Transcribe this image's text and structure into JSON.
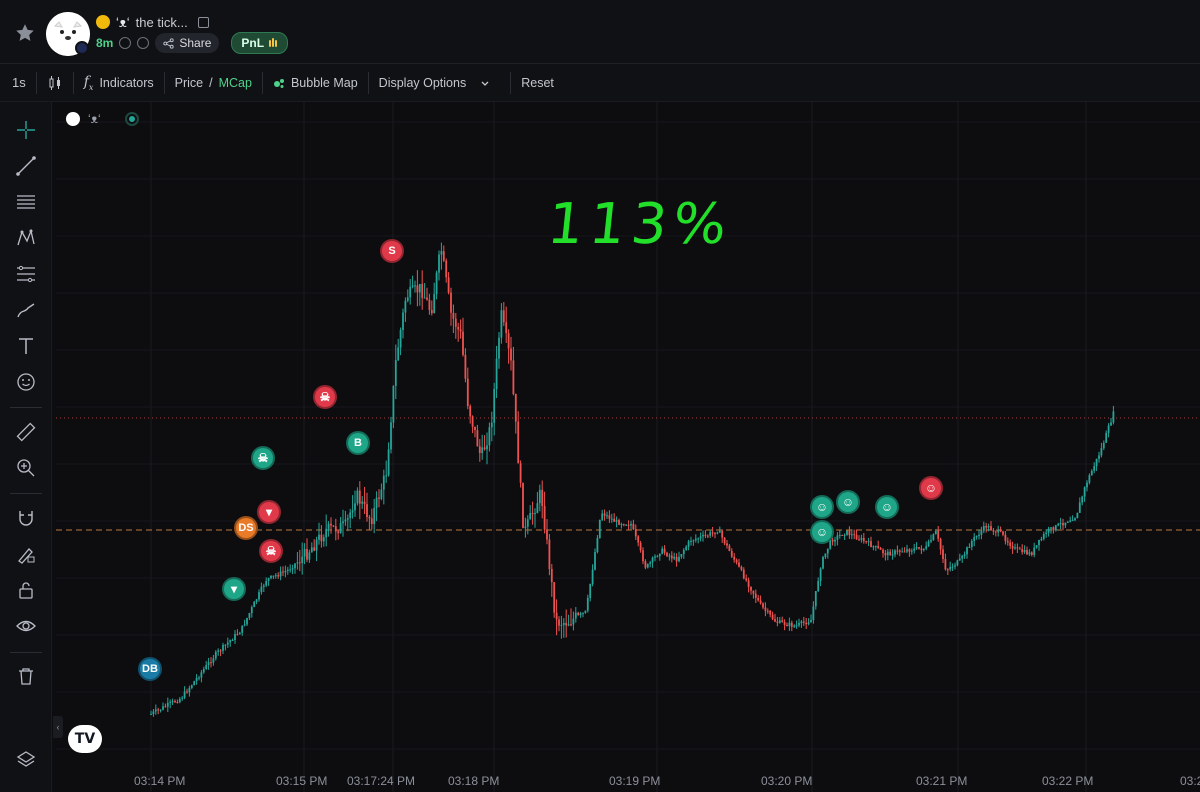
{
  "header": {
    "token_symbol": "ʻᴥʻ",
    "token_name": "the tick...",
    "age": "8m",
    "share_label": "Share",
    "pnl_label": "PnL"
  },
  "toolbar": {
    "interval": "1s",
    "indicators_label": "Indicators",
    "price_label": "Price",
    "slash": "/",
    "mcap_label": "MCap",
    "bubble_map_label": "Bubble Map",
    "display_options_label": "Display Options",
    "reset_label": "Reset"
  },
  "legend": {
    "symbol": "ʻᴥʻ"
  },
  "annotation": {
    "text": "113%"
  },
  "markers": [
    {
      "label": "S",
      "kind": "sell",
      "color": "#e03a4a"
    },
    {
      "label": "B",
      "kind": "buy",
      "color": "#1fa588"
    },
    {
      "label": "DS",
      "kind": "dev-sell",
      "color": "#e87a28"
    },
    {
      "label": "DB",
      "kind": "dev-buy",
      "color": "#1a7ca6"
    }
  ],
  "chart_data": {
    "type": "candlestick",
    "x_tick_labels": [
      "03:14 PM",
      "03:15 PM",
      "03:17:24 PM",
      "03:18 PM",
      "03:19 PM",
      "03:20 PM",
      "03:21 PM",
      "03:22 PM",
      "03:2"
    ],
    "annotation": "113%",
    "colors": {
      "up": "#26a69a",
      "down": "#ef5350",
      "accent": "#4fd18b"
    },
    "grid": true,
    "price_line_style": "dotted-red",
    "entry_line_style": "dashed-orange"
  }
}
